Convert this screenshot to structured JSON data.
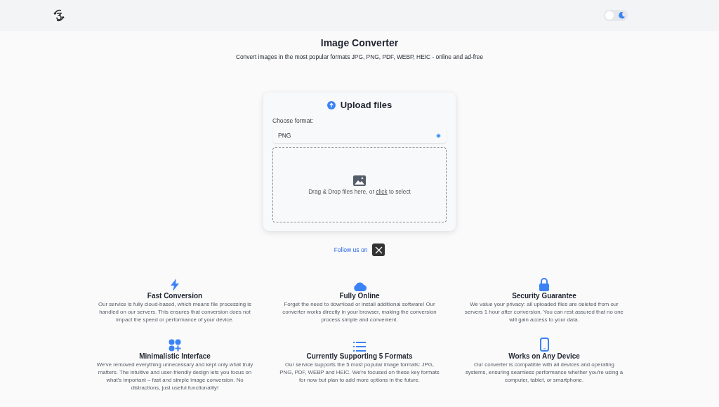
{
  "header": {
    "theme_toggle": {
      "on": false
    }
  },
  "title": "Image Converter",
  "subtitle": "Convert images in the most popular formats JPG, PNG, PDF, WEBP, HEIC - online and ad-free",
  "upload": {
    "heading": "Upload files",
    "format_label": "Choose format:",
    "format_value": "PNG",
    "dropzone": {
      "text_before": "Drag & Drop files here, or",
      "link": "click",
      "text_after": "to select"
    }
  },
  "follow": {
    "label": "Follow us on"
  },
  "features": [
    {
      "kind": "bolt",
      "title": "Fast Conversion",
      "text": "Our service is fully cloud-based, which means file processing is handled on our servers. This ensures that conversion does not impact the speed or performance of your device."
    },
    {
      "kind": "cloud",
      "title": "Fully Online",
      "text": "Forget the need to download or install additional software! Our converter works directly in your browser, making the conversion process simple and convenient."
    },
    {
      "kind": "lock",
      "title": "Security Guarantee",
      "text": "We value your privacy: all uploaded files are deleted from our servers 1 hour after conversion. You can rest assured that no one will gain access to your data."
    },
    {
      "kind": "apps",
      "title": "Minimalistic Interface",
      "text": "We've removed everything unnecessary and kept only what truly matters. The intuitive and user-friendly design lets you focus on what's important – fast and simple image conversion. No distractions, just useful functionality!"
    },
    {
      "kind": "list",
      "title": "Currently Supporting 5 Formats",
      "text": "Our service supports the 5 most popular image formats: JPG, PNG, PDF, WEBP and HEIC. We're focused on these key formats for now but plan to add more options in the future."
    },
    {
      "kind": "phone",
      "title": "Works on Any Device",
      "text": "Our converter is compatible with all devices and operating systems, ensuring seamless performance whether you're using a computer, tablet, or smartphone."
    }
  ]
}
